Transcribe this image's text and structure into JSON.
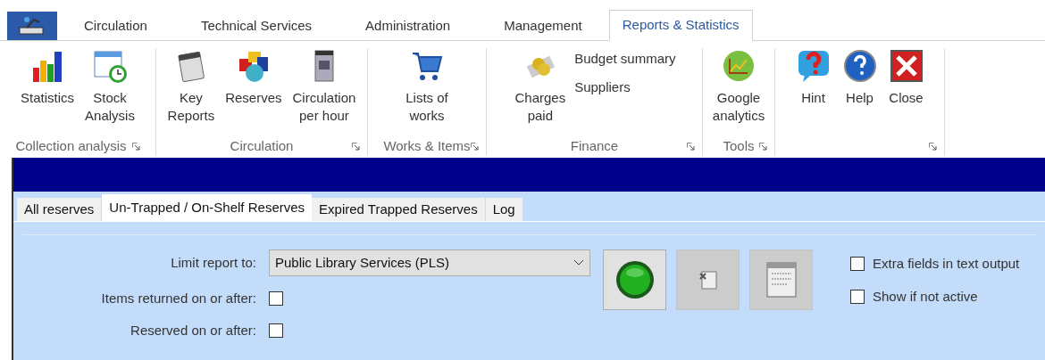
{
  "app_tabs": [
    {
      "label": "Circulation",
      "selected": false
    },
    {
      "label": "Technical Services",
      "selected": false
    },
    {
      "label": "Administration",
      "selected": false
    },
    {
      "label": "Management",
      "selected": false
    },
    {
      "label": "Reports & Statistics",
      "selected": true
    }
  ],
  "ribbon_groups": [
    {
      "label": "Collection analysis",
      "buttons": [
        {
          "kind": "large",
          "label": "Statistics"
        },
        {
          "kind": "large",
          "label": "Stock\nAnalysis"
        }
      ]
    },
    {
      "label": "Circulation",
      "buttons": [
        {
          "kind": "large",
          "label": "Key\nReports"
        },
        {
          "kind": "large",
          "label": "Reserves"
        },
        {
          "kind": "large",
          "label": "Circulation\nper hour"
        }
      ]
    },
    {
      "label": "Works & Items",
      "buttons": [
        {
          "kind": "large",
          "label": "Lists of\nworks"
        }
      ]
    },
    {
      "label": "Finance",
      "buttons": [
        {
          "kind": "large",
          "label": "Charges\npaid"
        },
        {
          "kind": "small",
          "label": "Budget summary"
        },
        {
          "kind": "small",
          "label": "Suppliers"
        }
      ]
    },
    {
      "label": "Tools",
      "buttons": [
        {
          "kind": "large",
          "label": "Google\nanalytics"
        }
      ]
    },
    {
      "buttons": [
        {
          "kind": "large",
          "label": "Hint"
        },
        {
          "kind": "large",
          "label": "Help"
        },
        {
          "kind": "large",
          "label": "Close"
        }
      ]
    }
  ],
  "report_tabs": [
    {
      "label": "All reserves",
      "selected": false
    },
    {
      "label": "Un-Trapped / On-Shelf Reserves",
      "selected": true
    },
    {
      "label": "Expired Trapped Reserves",
      "selected": false
    },
    {
      "label": "Log",
      "selected": false
    }
  ],
  "limit_report": {
    "label": "Limit report to:",
    "value": "Public Library Services (PLS)"
  },
  "date_filters": [
    {
      "label": "Items returned on or after:",
      "checked": false
    },
    {
      "label": "Reserved on or after:",
      "checked": false
    }
  ],
  "action_buttons": [
    {
      "disabled": false
    },
    {
      "disabled": true
    },
    {
      "disabled": true
    }
  ],
  "options": [
    {
      "label": "Extra fields in text output",
      "checked": false
    },
    {
      "label": "Show if not active",
      "checked": false
    }
  ]
}
